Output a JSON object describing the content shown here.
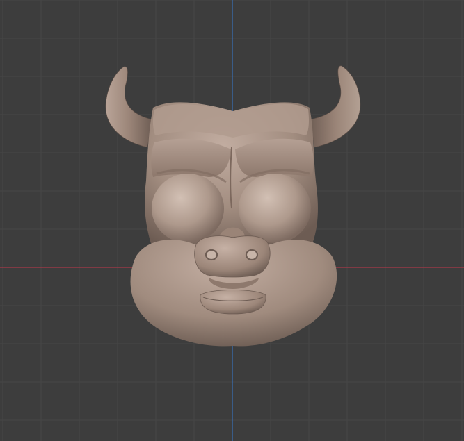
{
  "viewport": {
    "background_color": "#3d3d3d",
    "grid_minor_color": "#474747",
    "grid_major_color": "#2f2f2f",
    "axis_x_color": "#a83a48",
    "axis_y_color": "#3a6eb0",
    "sculpt_material_color": "#a48f82",
    "sculpt_shadow_color": "#5e4f47",
    "sculpt_highlight_color": "#c9b6aa",
    "mesh_name": "bull-head-sculpt",
    "view": "front-orthographic"
  }
}
